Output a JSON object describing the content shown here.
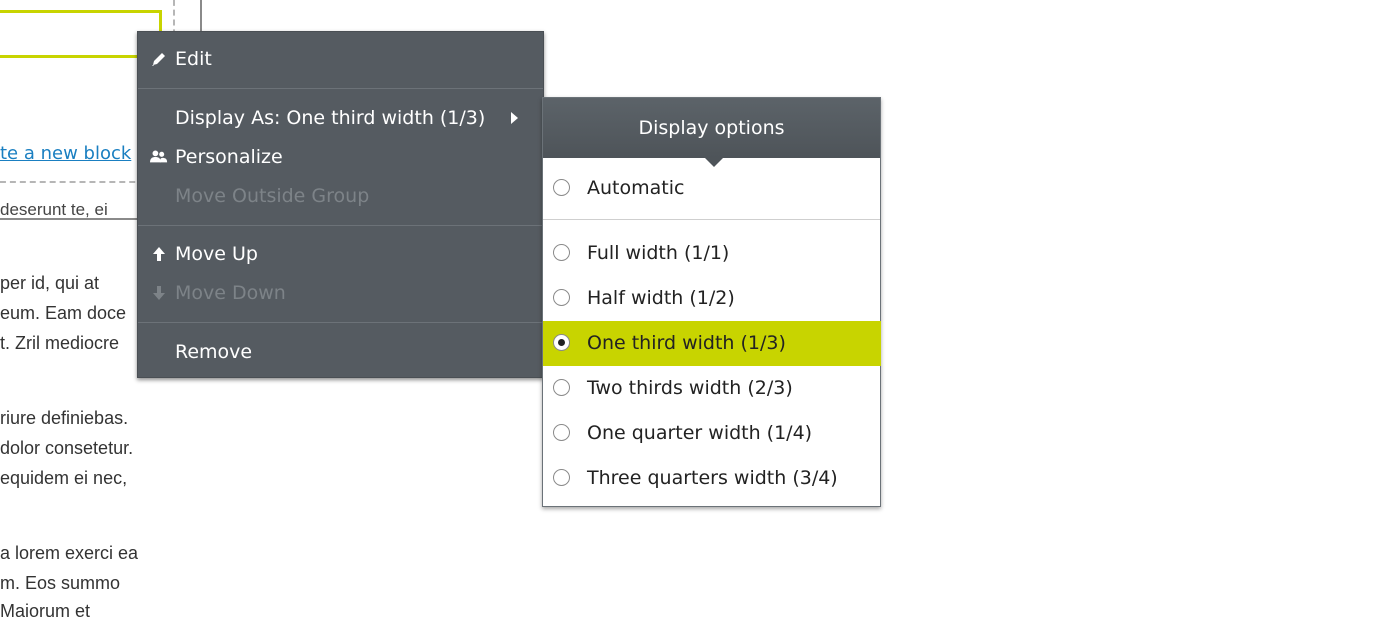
{
  "background": {
    "create_link": "te a new block",
    "clipped_text": "deserunt te, ei",
    "paragraph_lines": [
      "per id, qui at",
      "eum. Eam doce",
      "t. Zril mediocre",
      "riure definiebas.",
      "dolor consetetur.",
      "equidem ei nec,",
      "a lorem exerci ea",
      "m. Eos summo",
      "  Maiorum et"
    ]
  },
  "context_menu": {
    "items": [
      {
        "label": "Edit",
        "icon": "pencil-icon",
        "disabled": false
      },
      {
        "label": "Display As: One third width (1/3)",
        "icon": null,
        "disabled": false,
        "has_submenu": true
      },
      {
        "label": "Personalize",
        "icon": "users-icon",
        "disabled": false
      },
      {
        "label": "Move Outside Group",
        "icon": null,
        "disabled": true
      },
      {
        "label": "Move Up",
        "icon": "arrow-up-icon",
        "disabled": false
      },
      {
        "label": "Move Down",
        "icon": "arrow-down-icon",
        "disabled": true
      },
      {
        "label": "Remove",
        "icon": null,
        "disabled": false
      }
    ]
  },
  "display_options": {
    "title": "Display options",
    "options": [
      {
        "label": "Automatic",
        "selected": false
      },
      {
        "label": "Full width (1/1)",
        "selected": false
      },
      {
        "label": "Half width (1/2)",
        "selected": false
      },
      {
        "label": "One third width (1/3)",
        "selected": true
      },
      {
        "label": "Two thirds width (2/3)",
        "selected": false
      },
      {
        "label": "One quarter width (1/4)",
        "selected": false
      },
      {
        "label": "Three quarters width (3/4)",
        "selected": false
      }
    ],
    "selected_color": "#c8d400"
  },
  "colors": {
    "menu_bg": "#555b61",
    "link": "#1a7fc1",
    "accent": "#c8d400"
  }
}
